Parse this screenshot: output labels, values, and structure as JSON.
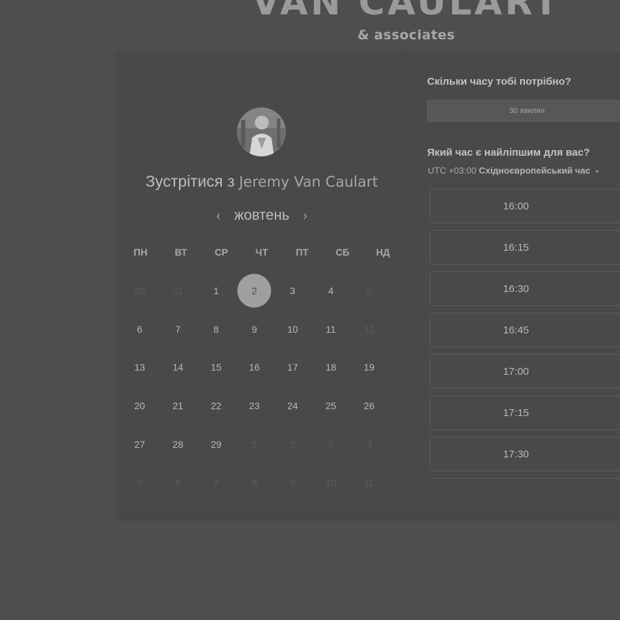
{
  "brand": {
    "name": "VAN CAULART",
    "sub": "& associates"
  },
  "meeting": {
    "prefix": "Зустрітися з",
    "host": "Jeremy Van Caulart"
  },
  "calendar": {
    "month": "жовтень",
    "prev_icon": "‹",
    "next_icon": "›",
    "weekdays": [
      "ПН",
      "ВТ",
      "СР",
      "ЧТ",
      "ПТ",
      "СБ",
      "НД"
    ],
    "days": [
      {
        "d": "30",
        "muted": true
      },
      {
        "d": "31",
        "muted": true
      },
      {
        "d": "1"
      },
      {
        "d": "2",
        "selected": true
      },
      {
        "d": "3"
      },
      {
        "d": "4"
      },
      {
        "d": "5",
        "muted": true
      },
      {
        "d": "6"
      },
      {
        "d": "7"
      },
      {
        "d": "8"
      },
      {
        "d": "9"
      },
      {
        "d": "10"
      },
      {
        "d": "11"
      },
      {
        "d": "12",
        "muted": true
      },
      {
        "d": "13"
      },
      {
        "d": "14"
      },
      {
        "d": "15"
      },
      {
        "d": "16"
      },
      {
        "d": "17"
      },
      {
        "d": "18"
      },
      {
        "d": "19"
      },
      {
        "d": "20"
      },
      {
        "d": "21"
      },
      {
        "d": "22"
      },
      {
        "d": "23"
      },
      {
        "d": "24"
      },
      {
        "d": "25"
      },
      {
        "d": "26"
      },
      {
        "d": "27"
      },
      {
        "d": "28"
      },
      {
        "d": "29"
      },
      {
        "d": "1",
        "muted": true
      },
      {
        "d": "2",
        "muted": true
      },
      {
        "d": "3",
        "muted": true
      },
      {
        "d": "4",
        "muted": true
      },
      {
        "d": "5",
        "muted": true
      },
      {
        "d": "6",
        "muted": true
      },
      {
        "d": "7",
        "muted": true
      },
      {
        "d": "8",
        "muted": true
      },
      {
        "d": "9",
        "muted": true
      },
      {
        "d": "10",
        "muted": true
      },
      {
        "d": "11",
        "muted": true
      }
    ]
  },
  "booking": {
    "duration_question": "Скільки часу тобі потрібно?",
    "duration_value": "30 хвилин",
    "time_question": "Який час є найліпшим для вас?",
    "tz_offset": "UTC +03:00",
    "tz_name": "Східноєвропейський час",
    "tz_caret": "▾",
    "slots": [
      "16:00",
      "16:15",
      "16:30",
      "16:45",
      "17:00",
      "17:15",
      "17:30",
      ""
    ]
  }
}
